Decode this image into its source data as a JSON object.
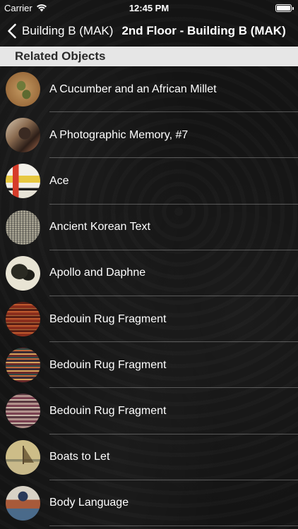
{
  "status_bar": {
    "carrier": "Carrier",
    "time": "12:45 PM",
    "wifi_icon": "wifi-icon",
    "battery_icon": "battery-icon"
  },
  "nav": {
    "back_label": "Building B (MAK)",
    "back_icon": "chevron-left-icon",
    "title": "2nd Floor - Building B (MAK)"
  },
  "section": {
    "title": "Related Objects"
  },
  "objects": [
    {
      "label": "A Cucumber and an African Millet",
      "thumb": "t-cucumber"
    },
    {
      "label": "A Photographic Memory, #7",
      "thumb": "t-photographic"
    },
    {
      "label": "Ace",
      "thumb": "t-ace"
    },
    {
      "label": "Ancient Korean Text",
      "thumb": "t-korean"
    },
    {
      "label": "Apollo and Daphne",
      "thumb": "t-apollo"
    },
    {
      "label": "Bedouin Rug Fragment",
      "thumb": "t-rug1"
    },
    {
      "label": "Bedouin Rug Fragment",
      "thumb": "t-rug2"
    },
    {
      "label": "Bedouin Rug Fragment",
      "thumb": "t-rug3"
    },
    {
      "label": "Boats to Let",
      "thumb": "t-boats"
    },
    {
      "label": "Body Language",
      "thumb": "t-body"
    }
  ],
  "colors": {
    "background": "#141414",
    "section_header_bg": "#e6e6e6",
    "section_header_text": "#2a2a2a",
    "text": "#ffffff"
  }
}
